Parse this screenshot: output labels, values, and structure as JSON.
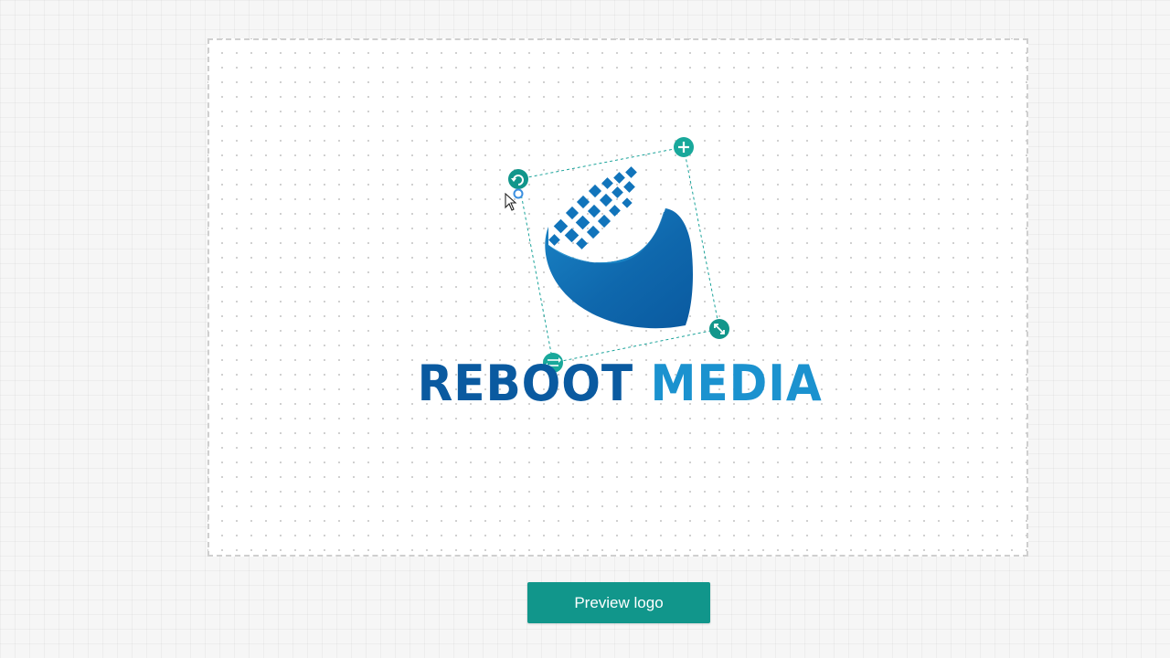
{
  "logo": {
    "brand_word_1": "REBOOT",
    "brand_word_2": "MEDIA",
    "mark_icon": "pixel-wave-emblem-icon"
  },
  "selection": {
    "rotate_icon": "rotate-icon",
    "add_icon": "plus-icon",
    "resize_icon": "diagonal-resize-icon",
    "flip_icon": "swap-arrows-icon"
  },
  "actions": {
    "preview_label": "Preview logo"
  },
  "colors": {
    "primary_blue": "#0a5aa0",
    "accent_blue": "#1b92cf",
    "teal": "#11968b",
    "teal_light": "#19a89b"
  }
}
